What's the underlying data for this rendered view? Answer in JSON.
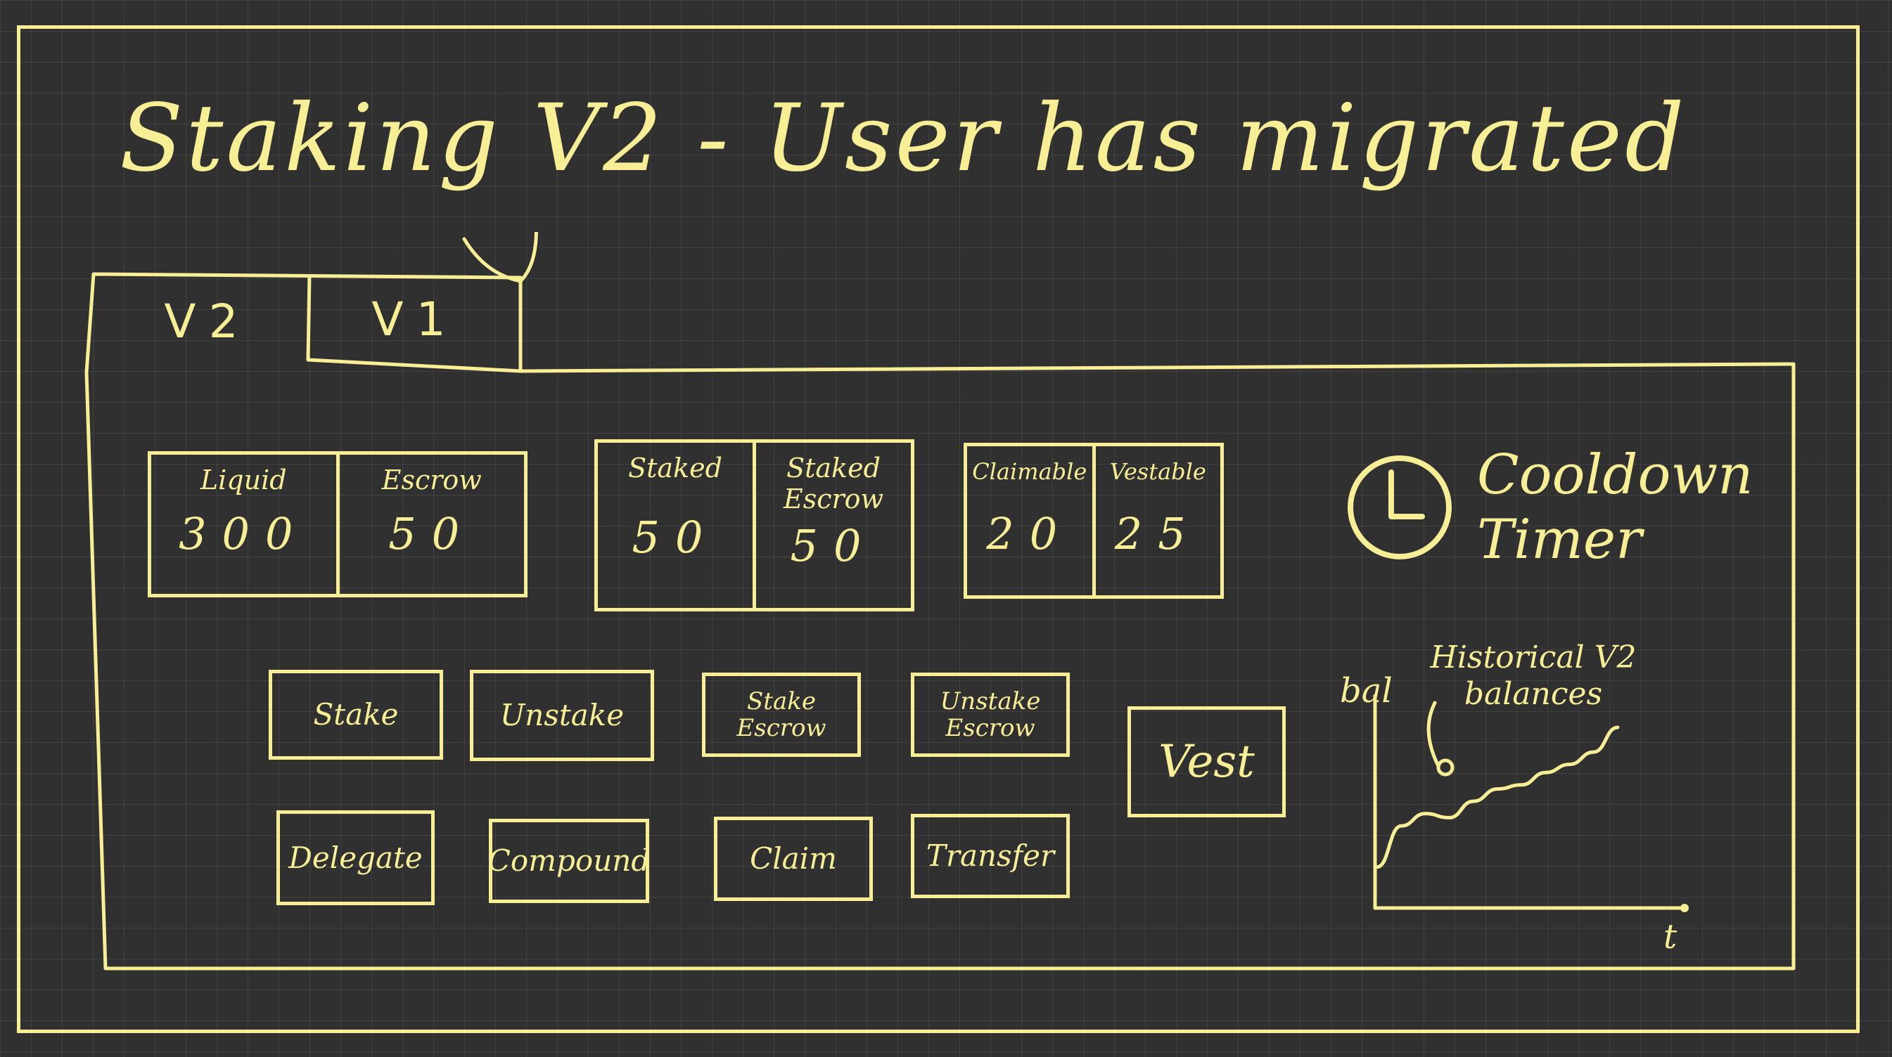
{
  "title": "Staking V2 - User has migrated",
  "tabs": [
    {
      "label": "V2",
      "active": true
    },
    {
      "label": "V1",
      "active": false
    }
  ],
  "balance_groups": [
    {
      "cells": [
        {
          "label": "Liquid",
          "value": "300"
        },
        {
          "label": "Escrow",
          "value": "50"
        }
      ]
    },
    {
      "cells": [
        {
          "label": "Staked",
          "value": "50"
        },
        {
          "label": "Staked Escrow",
          "value": "50"
        }
      ]
    },
    {
      "cells": [
        {
          "label": "Claimable",
          "value": "20"
        },
        {
          "label": "Vestable",
          "value": "25"
        }
      ]
    }
  ],
  "actions": {
    "stake": "Stake",
    "unstake": "Unstake",
    "stake_escrow": "Stake Escrow",
    "unstake_escrow": "Unstake Escrow",
    "vest": "Vest",
    "delegate": "Delegate",
    "compound": "Compound",
    "claim": "Claim",
    "transfer": "Transfer"
  },
  "timer": {
    "label": "Cooldown Timer",
    "icon": "clock-icon"
  },
  "chart_data": {
    "type": "line",
    "title": "Historical V2 balances",
    "xlabel": "t",
    "ylabel": "bal",
    "x": [
      0,
      1,
      2,
      3,
      4,
      5,
      6,
      7,
      8,
      9,
      10
    ],
    "series": [
      {
        "values": [
          1.0,
          2.0,
          2.3,
          2.2,
          2.6,
          2.9,
          3.0,
          3.3,
          3.5,
          3.8,
          4.4
        ]
      }
    ],
    "ylim": [
      0,
      5
    ],
    "grid": false
  },
  "colors": {
    "ink": "#f7ee96",
    "background": "#303030"
  }
}
